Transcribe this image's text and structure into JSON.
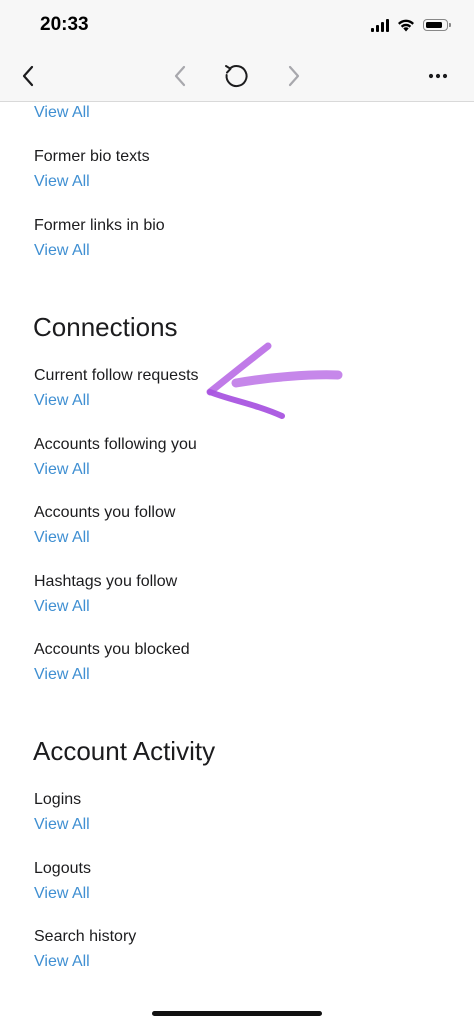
{
  "status_bar": {
    "time": "20:33"
  },
  "nav_bar": {
    "back_icon": "chevron-left-icon",
    "prev_icon": "chevron-left-icon",
    "reload_icon": "reload-icon",
    "next_icon": "chevron-right-icon",
    "more_icon": "more-horizontal-icon"
  },
  "top_items": [
    {
      "view_all": "View All"
    },
    {
      "title": "Former bio texts",
      "view_all": "View All"
    },
    {
      "title": "Former links in bio",
      "view_all": "View All"
    }
  ],
  "connections": {
    "heading": "Connections",
    "items": [
      {
        "title": "Current follow requests",
        "view_all": "View All"
      },
      {
        "title": "Accounts following you",
        "view_all": "View All"
      },
      {
        "title": "Accounts you follow",
        "view_all": "View All"
      },
      {
        "title": "Hashtags you follow",
        "view_all": "View All"
      },
      {
        "title": "Accounts you blocked",
        "view_all": "View All"
      }
    ]
  },
  "account_activity": {
    "heading": "Account Activity",
    "items": [
      {
        "title": "Logins",
        "view_all": "View All"
      },
      {
        "title": "Logouts",
        "view_all": "View All"
      },
      {
        "title": "Search history",
        "view_all": "View All"
      }
    ]
  },
  "colors": {
    "link": "#3f8fd2",
    "annotation": "#b76ee6"
  },
  "annotation": {
    "icon": "purple-hand-drawn-arrow-icon"
  }
}
